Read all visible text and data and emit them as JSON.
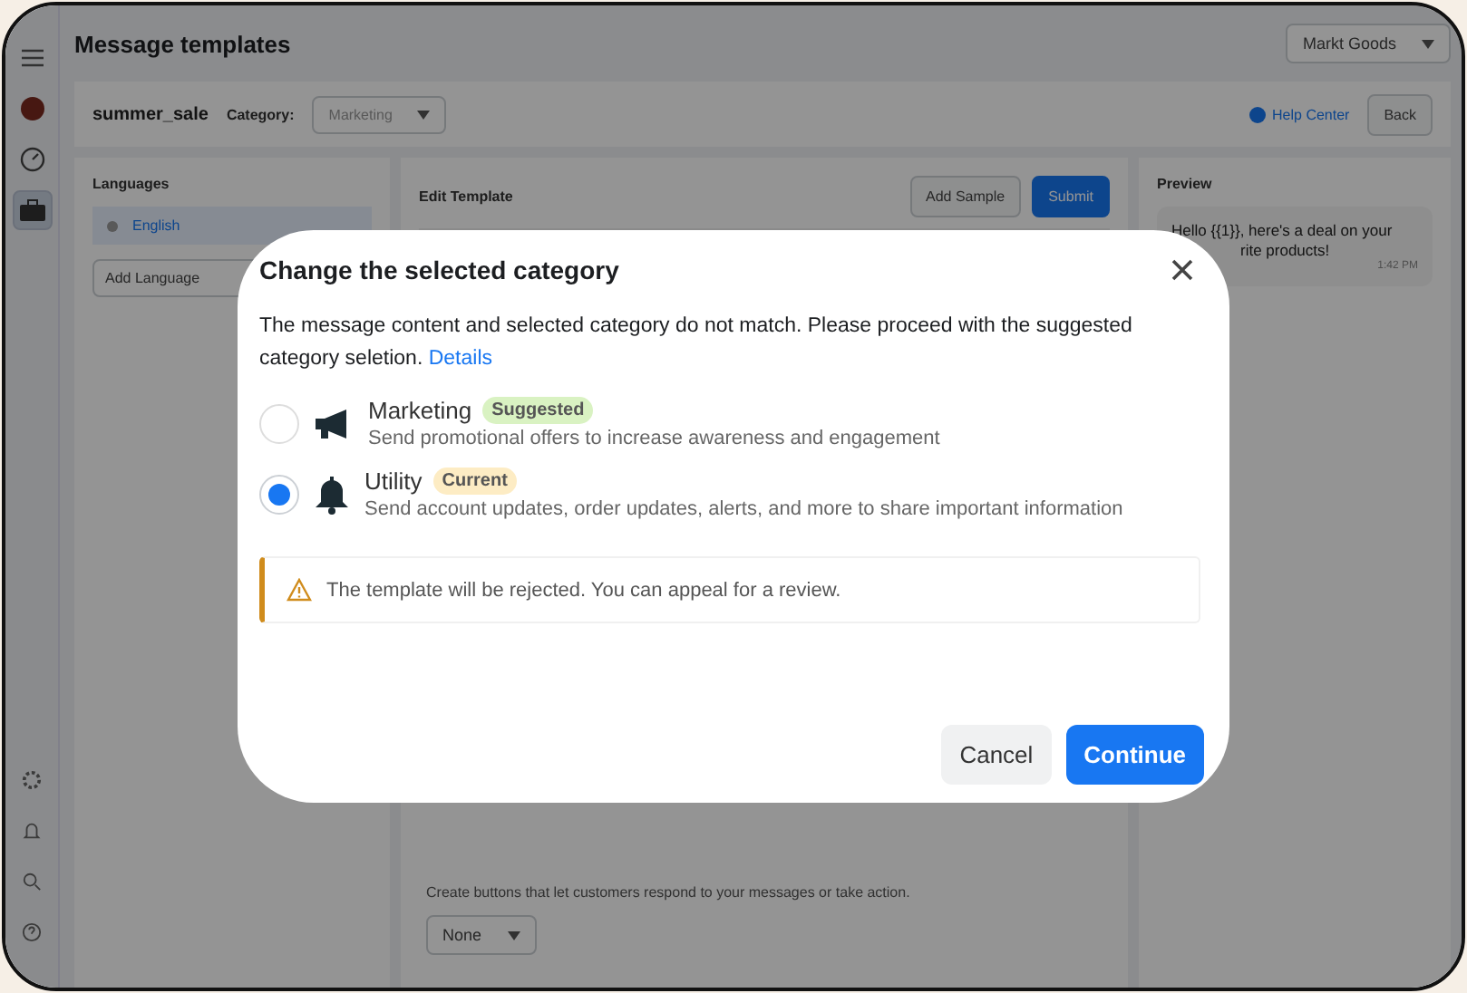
{
  "header": {
    "title": "Message templates",
    "account": "Markt Goods"
  },
  "rail": {
    "top": [
      {
        "kind": "menu"
      },
      {
        "kind": "avatar"
      },
      {
        "kind": "gauge"
      },
      {
        "kind": "briefcase",
        "selected": true
      }
    ],
    "bottom": [
      {
        "kind": "gear"
      },
      {
        "kind": "bell"
      },
      {
        "kind": "search"
      },
      {
        "kind": "help"
      }
    ]
  },
  "toolbar": {
    "name": "summer_sale",
    "category_label": "Category:",
    "category_value": "Marketing",
    "help": "Help Center",
    "back": "Back"
  },
  "languages": {
    "title": "Languages",
    "items": [
      {
        "label": "English",
        "selected": true
      }
    ],
    "add": "Add Language"
  },
  "editor": {
    "title": "Edit Template",
    "add_sample": "Add Sample",
    "submit": "Submit",
    "buttons_hint": "Create buttons that let customers respond to your messages or take action.",
    "buttons_value": "None"
  },
  "preview": {
    "title": "Preview",
    "line_1": "Hello {{1}}, here's a deal on your",
    "line_2": "rite products!",
    "time": "1:42 PM"
  },
  "dialog": {
    "title": "Change the selected category",
    "message": "The message content and selected category do not match. Please proceed with the suggested category seletion.",
    "link": "Details",
    "options": [
      {
        "kind": "megaphone",
        "label": "Marketing",
        "badge": "Suggested",
        "color": "#d9f2c2",
        "description": "Send promotional offers to increase awareness and engagement",
        "selected": false
      },
      {
        "kind": "bell",
        "label": "Utility",
        "badge": "Current",
        "color": "#fdecc4",
        "description": "Send account updates, order updates, alerts, and more to share important information",
        "selected": true
      }
    ],
    "warning": "The template will be rejected. You can appeal for a review.",
    "cancel": "Cancel",
    "continue": "Continue"
  }
}
